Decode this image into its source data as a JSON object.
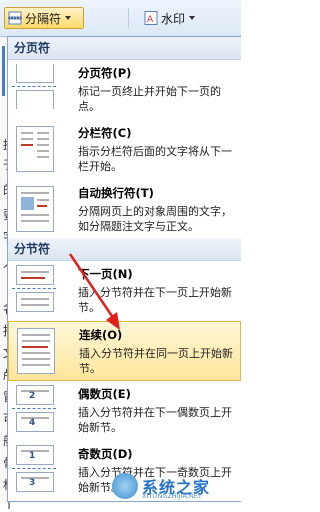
{
  "ribbon": {
    "breaks_button": "分隔符",
    "watermark_button": "水印"
  },
  "menu": {
    "page_breaks_header": "分页符",
    "section_breaks_header": "分节符",
    "items": [
      {
        "title": "分页符(P)",
        "desc": "标记一页终止并开始下一页的点。"
      },
      {
        "title": "分栏符(C)",
        "desc": "指示分栏符后面的文字将从下一栏开始。"
      },
      {
        "title": "自动换行符(T)",
        "desc": "分隔网页上的对象周围的文字，如分隔题注文字与正文。"
      },
      {
        "title": "下一页(N)",
        "desc": "插入分节符并在下一页上开始新节。"
      },
      {
        "title": "连续(O)",
        "desc": "插入分节符并在同一页上开始新节。"
      },
      {
        "title": "偶数页(E)",
        "desc": "插入分节符并在下一偶数页上开始新节。"
      },
      {
        "title": "奇数页(D)",
        "desc": "插入分节符并在下一奇数页上开始新节。"
      }
    ],
    "thumb_numbers": {
      "even": [
        "2",
        "4"
      ],
      "odd": [
        "1",
        "3"
      ]
    }
  },
  "doc_chars": [
    "提",
    "于",
    "的",
    "要",
    "字",
    "人",
    "名",
    "推",
    "文",
    "颅",
    "冒",
    "可",
    "舶",
    "骨",
    "杯",
    "i"
  ],
  "watermark": {
    "name": "系统之家",
    "url": "XITONGZHIJIA.NET"
  },
  "colors": {
    "highlight": "#ffe59a",
    "arrow": "#e0201c",
    "header_bg": "#dbe5f1"
  }
}
